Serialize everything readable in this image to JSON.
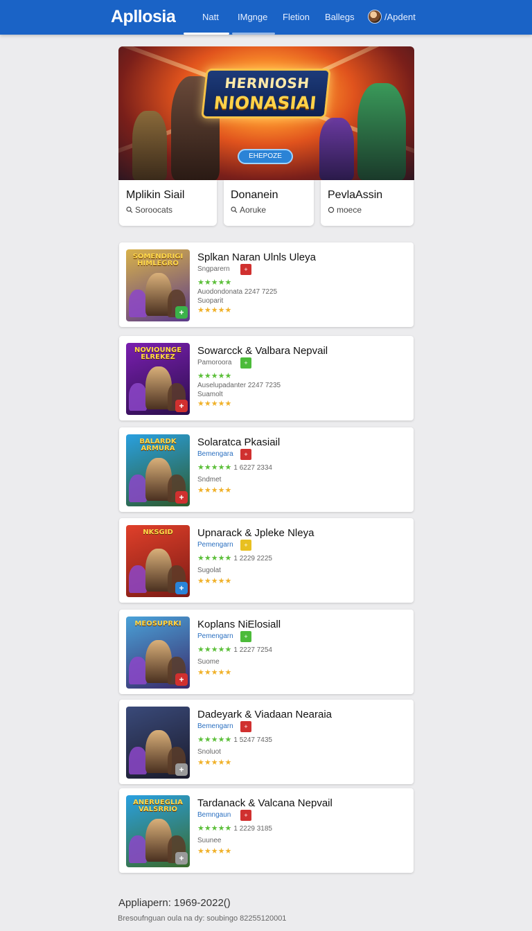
{
  "header": {
    "brand": "Apllosia",
    "nav": [
      "Natt",
      "IMgnge",
      "Fletion",
      "Ballegs"
    ],
    "account_label": "/Apdent"
  },
  "hero": {
    "title_line1": "HERNIOSH",
    "title_line2": "NIONASIAI",
    "cta_label": "EHEPOZE"
  },
  "features": [
    {
      "title": "Mplikin Siail",
      "subtitle": "Soroocats",
      "icon": "search-icon"
    },
    {
      "title": "Donanein",
      "subtitle": "Aoruke",
      "icon": "search-icon"
    },
    {
      "title": "PevlaAssin",
      "subtitle": "moece",
      "icon": "circle-icon"
    }
  ],
  "games": [
    {
      "title": "Splkan Naran Ulnls Uleya",
      "category": "Sngparern",
      "badge": "+",
      "badge_color": "#d0302f",
      "line2": "Auodondonata 2247 7225",
      "line3": "Suoparit",
      "ratings_meta": "",
      "thumb_banner": "SOMENDRIGI HIMLEGRO",
      "thumb_bg": [
        "#d8b24a",
        "#5a3a8a"
      ],
      "corner": "+",
      "corner_color": "#3bb24a"
    },
    {
      "title": "Sowarcck & Valbara Nepvail",
      "category": "Pamoroora",
      "badge": "+",
      "badge_color": "#4cbb3a",
      "line2": "Auselupadanter 2247 7235",
      "line3": "Suamolt",
      "ratings_meta": "",
      "thumb_banner": "NOVIOUNGE ELREKEZ",
      "thumb_bg": [
        "#7a1fb0",
        "#2a0e4a"
      ],
      "corner": "+",
      "corner_color": "#d0302f"
    },
    {
      "title": "Solaratca Pkasiail",
      "category": "Bemengara",
      "badge": "+",
      "badge_color": "#d0302f",
      "line2": "",
      "line3": "Sndmet",
      "ratings_meta": "1 6227 2334",
      "thumb_banner": "BALARDK ARMURA",
      "thumb_bg": [
        "#2aa0e0",
        "#2e5a2a"
      ],
      "corner": "+",
      "corner_color": "#d0302f"
    },
    {
      "title": "Upnarack & Jpleke Nleya",
      "category": "Pemengarn",
      "badge": "+",
      "badge_color": "#e8c020",
      "line2": "",
      "line3": "Sugolat",
      "ratings_meta": "1 2229 2225",
      "thumb_banner": "NKSGID",
      "thumb_bg": [
        "#e0402a",
        "#7a1a14"
      ],
      "corner": "+",
      "corner_color": "#2a84d8"
    },
    {
      "title": "Koplans NiElosiall",
      "category": "Pemengarn",
      "badge": "+",
      "badge_color": "#4cbb3a",
      "line2": "",
      "line3": "Suome",
      "ratings_meta": "1 2227 7254",
      "thumb_banner": "MEOSUPRKI",
      "thumb_bg": [
        "#4aa2d8",
        "#3a2a6a"
      ],
      "corner": "+",
      "corner_color": "#d0302f"
    },
    {
      "title": "Dadeyark & Viadaan Nearaia",
      "category": "Bemengarn",
      "badge": "+",
      "badge_color": "#d0302f",
      "line2": "",
      "line3": "Snoluot",
      "ratings_meta": "1 5247 7435",
      "thumb_banner": "",
      "thumb_bg": [
        "#3a4a7a",
        "#1a1a2a"
      ],
      "corner": "+",
      "corner_color": "#9a9a9a"
    },
    {
      "title": "Tardanack & Valcana Nepvail",
      "category": "Bemngaun",
      "badge": "+",
      "badge_color": "#d0302f",
      "line2": "",
      "line3": "Suunee",
      "ratings_meta": "1 2229 3185",
      "thumb_banner": "ANERUEGLIA VALSRRIO",
      "thumb_bg": [
        "#2aa0e0",
        "#3a6a2a"
      ],
      "corner": "+",
      "corner_color": "#9a9a9a"
    }
  ],
  "footer": {
    "title": "Appliapern: 1969-2022()",
    "subtitle": "Bresoufnguan oula na dy: soubingo 82255120001"
  },
  "colors": {
    "brand_blue": "#1a63c6",
    "star_green": "#5cbf3a",
    "star_gold": "#f0b12a"
  }
}
